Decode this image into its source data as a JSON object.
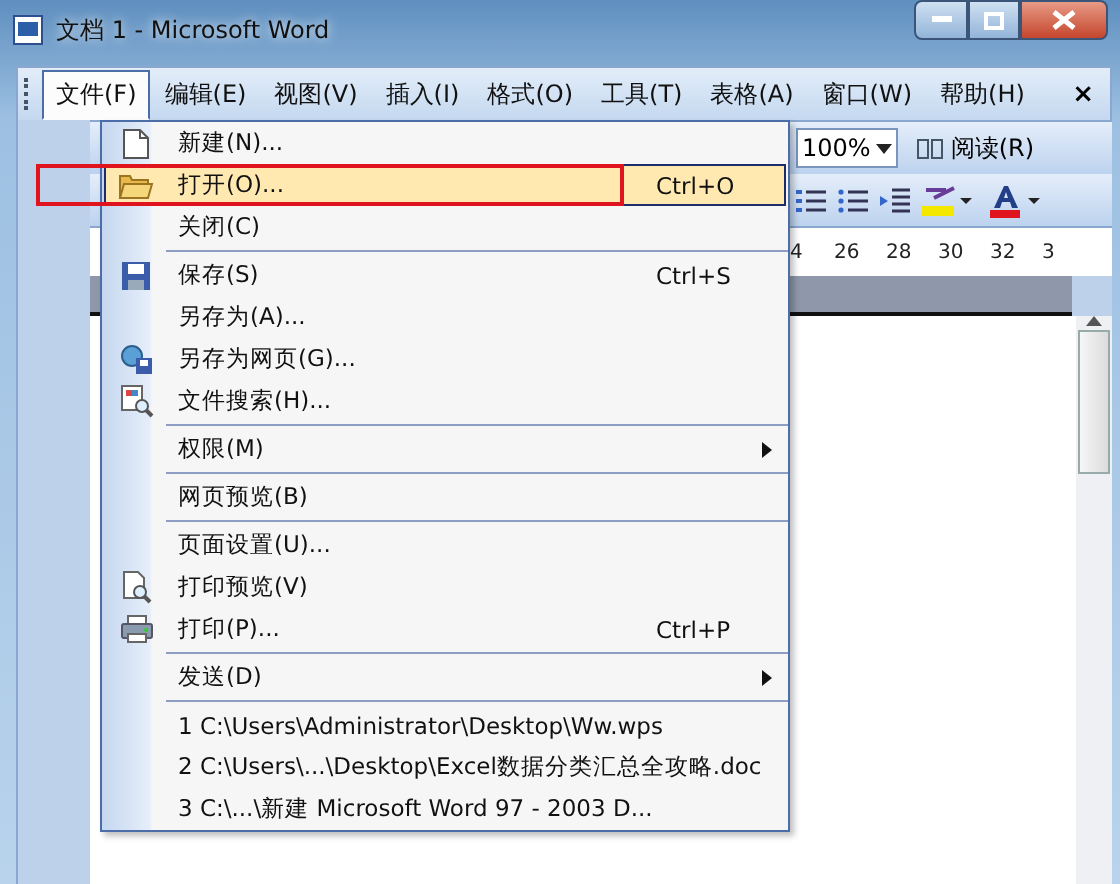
{
  "window": {
    "title": "文档 1 - Microsoft Word"
  },
  "menubar": {
    "items": [
      {
        "label": "文件(F)",
        "selected": true
      },
      {
        "label": "编辑(E)",
        "selected": false
      },
      {
        "label": "视图(V)",
        "selected": false
      },
      {
        "label": "插入(I)",
        "selected": false
      },
      {
        "label": "格式(O)",
        "selected": false
      },
      {
        "label": "工具(T)",
        "selected": false
      },
      {
        "label": "表格(A)",
        "selected": false
      },
      {
        "label": "窗口(W)",
        "selected": false
      },
      {
        "label": "帮助(H)",
        "selected": false
      }
    ],
    "close": "×"
  },
  "toolbar": {
    "zoom": "100%",
    "read_button": "阅读(R)"
  },
  "ruler": {
    "labels": [
      "4",
      "26",
      "28",
      "30",
      "32",
      "3"
    ]
  },
  "file_menu": {
    "groups": [
      [
        {
          "label": "新建(N)...",
          "submenu": false,
          "selected": false
        },
        {
          "label": "打开(O)...",
          "shortcut": "Ctrl+O",
          "submenu": false,
          "selected": true
        },
        {
          "label": "关闭(C)",
          "submenu": false,
          "selected": false
        }
      ],
      [
        {
          "label": "保存(S)",
          "shortcut": "Ctrl+S",
          "submenu": false,
          "selected": false
        },
        {
          "label": "另存为(A)...",
          "submenu": false,
          "selected": false
        },
        {
          "label": "另存为网页(G)...",
          "submenu": false,
          "selected": false
        },
        {
          "label": "文件搜索(H)...",
          "submenu": false,
          "selected": false
        }
      ],
      [
        {
          "label": "权限(M)",
          "submenu": true,
          "selected": false
        }
      ],
      [
        {
          "label": "网页预览(B)",
          "submenu": false,
          "selected": false
        }
      ],
      [
        {
          "label": "页面设置(U)...",
          "submenu": false,
          "selected": false
        },
        {
          "label": "打印预览(V)",
          "submenu": false,
          "selected": false
        },
        {
          "label": "打印(P)...",
          "shortcut": "Ctrl+P",
          "submenu": false,
          "selected": false
        }
      ],
      [
        {
          "label": "发送(D)",
          "submenu": true,
          "selected": false
        }
      ],
      [
        {
          "label": "1 C:\\Users\\Administrator\\Desktop\\Ww.wps",
          "submenu": false,
          "selected": false
        },
        {
          "label": "2 C:\\Users\\...\\Desktop\\Excel数据分类汇总全攻略.doc",
          "submenu": false,
          "selected": false
        },
        {
          "label": "3 C:\\...\\新建 Microsoft Word 97 - 2003 D...",
          "submenu": false,
          "selected": false
        }
      ]
    ]
  }
}
